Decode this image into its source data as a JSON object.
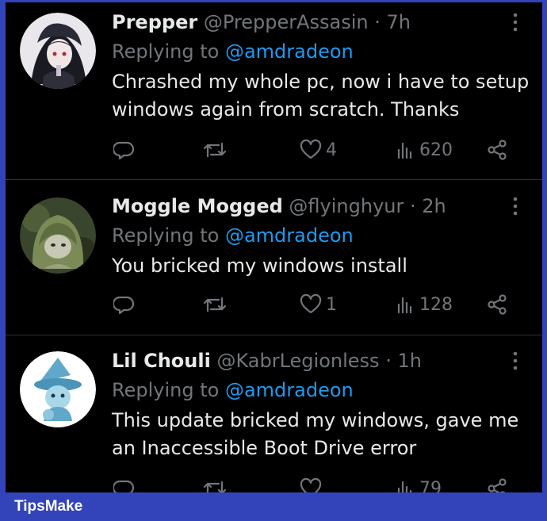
{
  "tweets": [
    {
      "display_name": "Prepper",
      "handle": "@PrepperAssasin",
      "separator": "·",
      "time": "7h",
      "replying_prefix": "Replying to",
      "replying_to": "@amdradeon",
      "text": "Chrashed my whole pc, now i have to setup windows again from scratch. Thanks",
      "likes": "4",
      "views": "620",
      "avatar_icon": "anime-girl-avatar"
    },
    {
      "display_name": "Moggle Mogged",
      "handle": "@flyinghyur",
      "separator": "·",
      "time": "2h",
      "replying_prefix": "Replying to",
      "replying_to": "@amdradeon",
      "text": "You bricked my windows install",
      "likes": "1",
      "views": "128",
      "avatar_icon": "hooded-character-avatar"
    },
    {
      "display_name": "Lil Chouli",
      "handle": "@KabrLegionless",
      "separator": "·",
      "time": "1h",
      "replying_prefix": "Replying to",
      "replying_to": "@amdradeon",
      "text": "This update bricked my windows, gave me an Inaccessible Boot Drive error",
      "likes": "",
      "views": "79",
      "avatar_icon": "witch-hat-character-avatar"
    }
  ],
  "footer": {
    "brand": "TipsMake"
  },
  "colors": {
    "background": "#000000",
    "frame": "#3344bb",
    "text": "#e7e9ea",
    "muted": "#71767b",
    "link": "#1d9bf0"
  }
}
